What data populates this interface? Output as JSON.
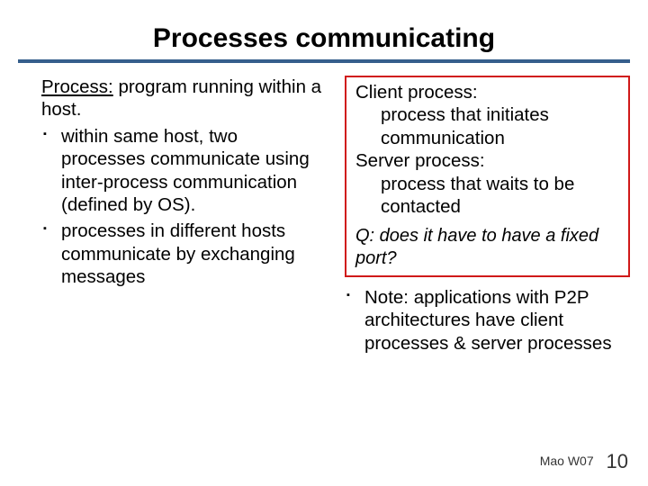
{
  "title": "Processes communicating",
  "left": {
    "defLabel": "Process:",
    "defText": " program running within a host.",
    "bullets": [
      {
        "pre": "within same host, two processes communicate using  ",
        "u": "inter-process communication",
        "post": " (defined by OS)."
      },
      {
        "pre": "processes in different hosts communicate by exchanging ",
        "u": "messages",
        "post": ""
      }
    ]
  },
  "right": {
    "box": {
      "client": {
        "label": "Client process:",
        "text": " process that initiates communication"
      },
      "server": {
        "label": "Server process:",
        "text": " process that waits to be contacted"
      },
      "question": "Q: does it have to have a fixed port?"
    },
    "note": "Note: applications with P2P architectures have client processes & server processes"
  },
  "footer": {
    "credit": "Mao W07",
    "page": "10"
  }
}
